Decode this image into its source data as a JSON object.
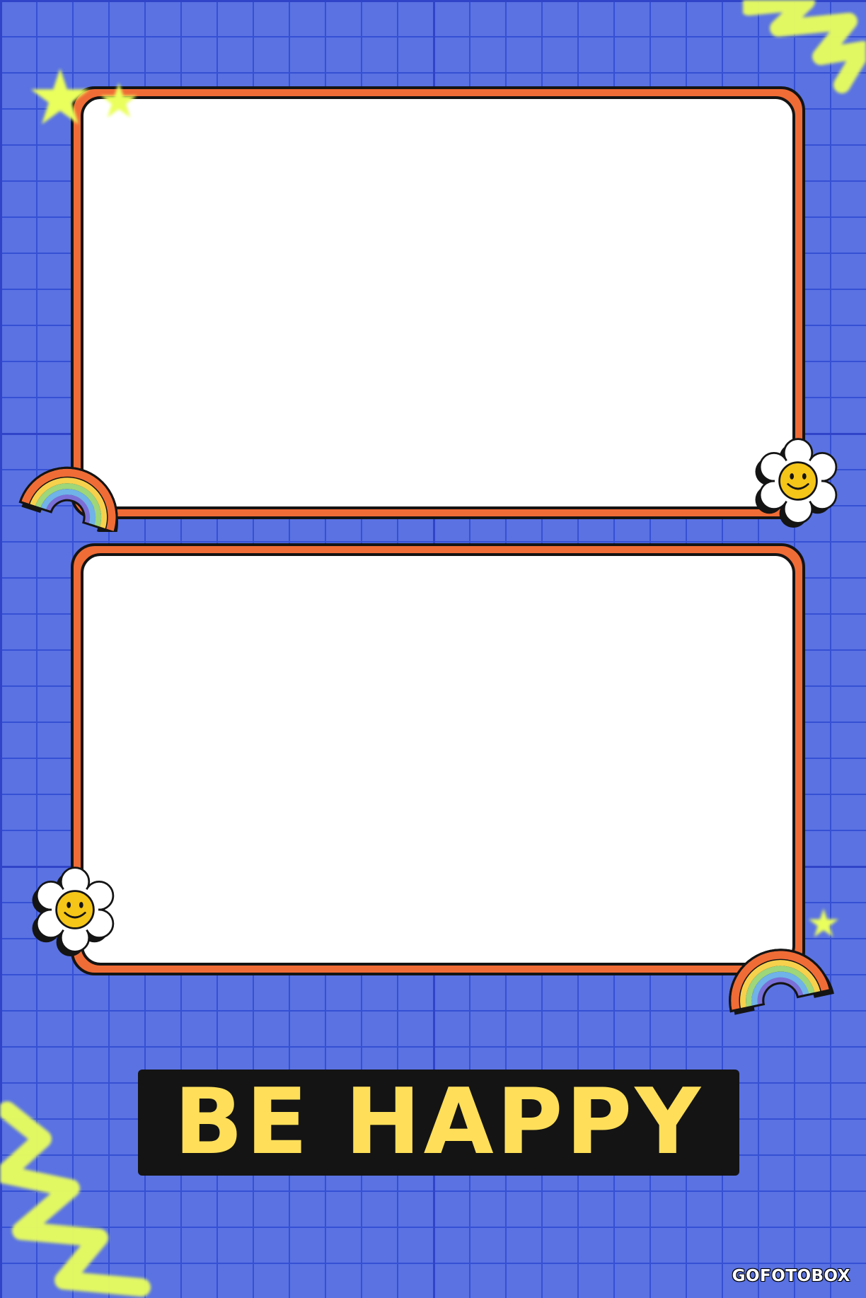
{
  "headline": "BE HAPPY",
  "watermark": "GOFOTOBOX",
  "colors": {
    "background": "#5a72e2",
    "grid_line": "#2f44c8",
    "frame_border": "#f06c36",
    "outline": "#141414",
    "headline_text": "#ffdf5a",
    "accent_yellow": "#eaff5c",
    "slot_fill": "#ffffff"
  },
  "photo_slots": [
    {
      "name": "photo-slot-1"
    },
    {
      "name": "photo-slot-2"
    }
  ],
  "decorations": [
    "star-icon",
    "rainbow-icon",
    "smiley-flower-icon",
    "zigzag-icon"
  ]
}
